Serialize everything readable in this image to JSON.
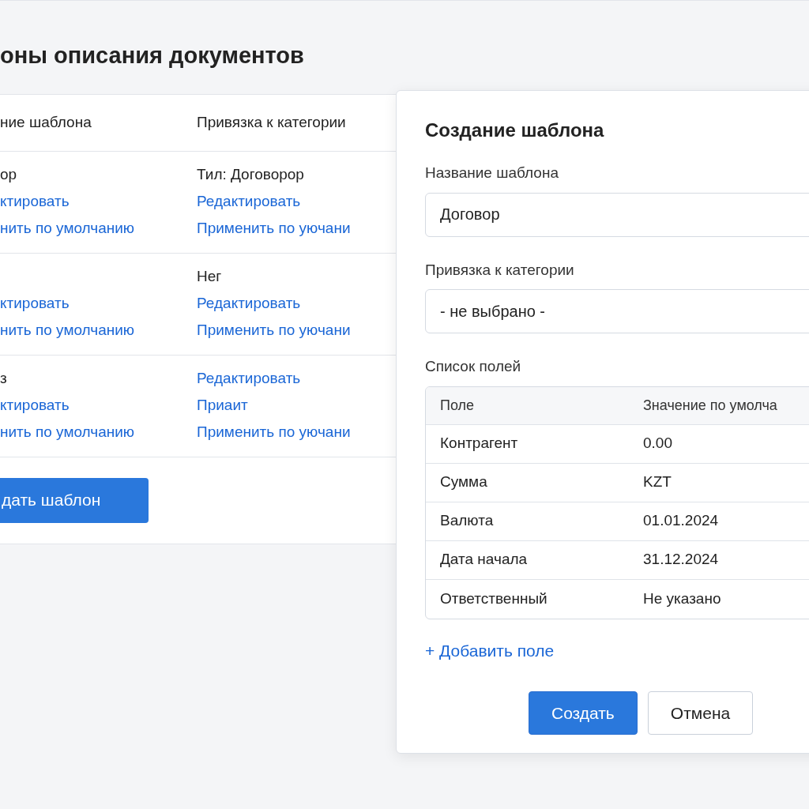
{
  "page_title": "оны описания документов",
  "templates_table": {
    "columns": [
      "ние шаблона",
      "Привязка к категории"
    ],
    "rows": [
      {
        "cells": [
          [
            {
              "kind": "text",
              "text": "ор"
            },
            {
              "kind": "link",
              "text": "ктировать"
            },
            {
              "kind": "link",
              "text": "нить по умолчанию"
            }
          ],
          [
            {
              "kind": "text",
              "text": "Тил: Договорор"
            },
            {
              "kind": "link",
              "text": "Редактировать"
            },
            {
              "kind": "link",
              "text": "Применить по уючани"
            }
          ]
        ]
      },
      {
        "cells": [
          [
            {
              "kind": "link",
              "text": "ктировать"
            },
            {
              "kind": "link",
              "text": "нить по умолчанию"
            }
          ],
          [
            {
              "kind": "text",
              "text": "Нег"
            },
            {
              "kind": "link",
              "text": "Редактировать"
            },
            {
              "kind": "link",
              "text": "Применить по уючани"
            }
          ]
        ]
      },
      {
        "cells": [
          [
            {
              "kind": "text",
              "text": "з"
            },
            {
              "kind": "link",
              "text": "ктировать"
            },
            {
              "kind": "link",
              "text": "нить по умолчанию"
            }
          ],
          [
            {
              "kind": "link",
              "text": "Редактировать"
            },
            {
              "kind": "link",
              "text": "Приаит"
            },
            {
              "kind": "link",
              "text": "Применить по уючани"
            }
          ]
        ]
      }
    ]
  },
  "create_button": "дать шаблон",
  "dialog": {
    "title": "Создание шаблона",
    "name_field": {
      "label": "Название шаблона",
      "value": "Договор"
    },
    "category_select": {
      "label": "Привязка к категории",
      "value": "- не выбрано -"
    },
    "fields_list": {
      "label": "Список полей",
      "columns": [
        "Поле",
        "Значение по умолча"
      ],
      "rows": [
        [
          "Контрагент",
          "0.00"
        ],
        [
          "Сумма",
          "KZT"
        ],
        [
          "Валюта",
          "01.01.2024"
        ],
        [
          "Дата начала",
          "31.12.2024"
        ],
        [
          "Ответственный",
          "Не указано"
        ]
      ]
    },
    "add_field_link": "+ Добавить поле",
    "buttons": [
      {
        "label": "Создать",
        "kind": "primary"
      },
      {
        "label": "Отмена",
        "kind": "secondary"
      }
    ]
  }
}
